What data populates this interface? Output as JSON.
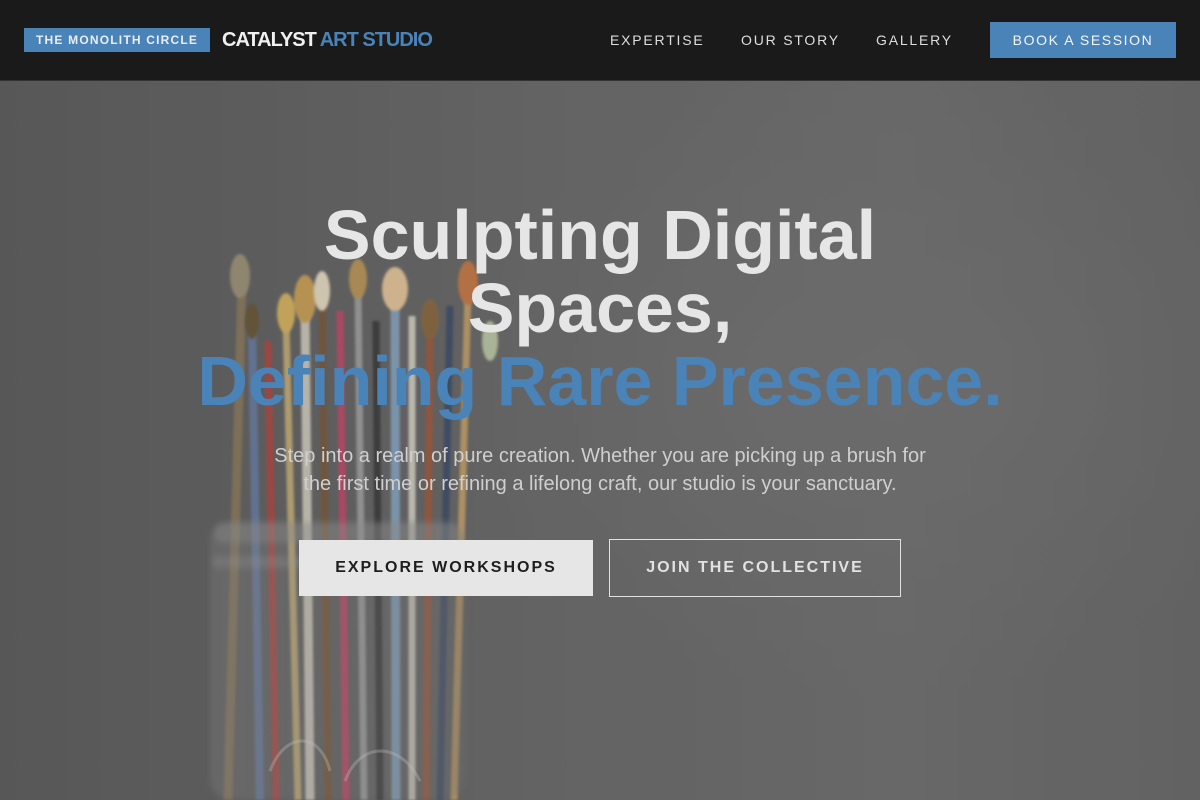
{
  "nav": {
    "badge": "THE MONOLITH CIRCLE",
    "brand_primary": "CATALYST",
    "brand_accent": "ART STUDIO",
    "links": [
      "EXPERTISE",
      "OUR STORY",
      "GALLERY"
    ],
    "cta": "BOOK A SESSION"
  },
  "hero": {
    "title_line1": "Sculpting Digital",
    "title_line2": "Spaces,",
    "title_accent": "Defining Rare Presence.",
    "subtitle_line1": "Step into a realm of pure creation. Whether you are picking up a brush for",
    "subtitle_line2": "the first time or refining a lifelong craft, our studio is your sanctuary.",
    "primary_button": "EXPLORE WORKSHOPS",
    "secondary_button": "JOIN THE COLLECTIVE",
    "background_image": "paintbrushes-in-glass-jar"
  },
  "colors": {
    "accent": "#4a83b8",
    "nav_bg": "#1a1a1a",
    "text_light": "#e6e6e6"
  }
}
